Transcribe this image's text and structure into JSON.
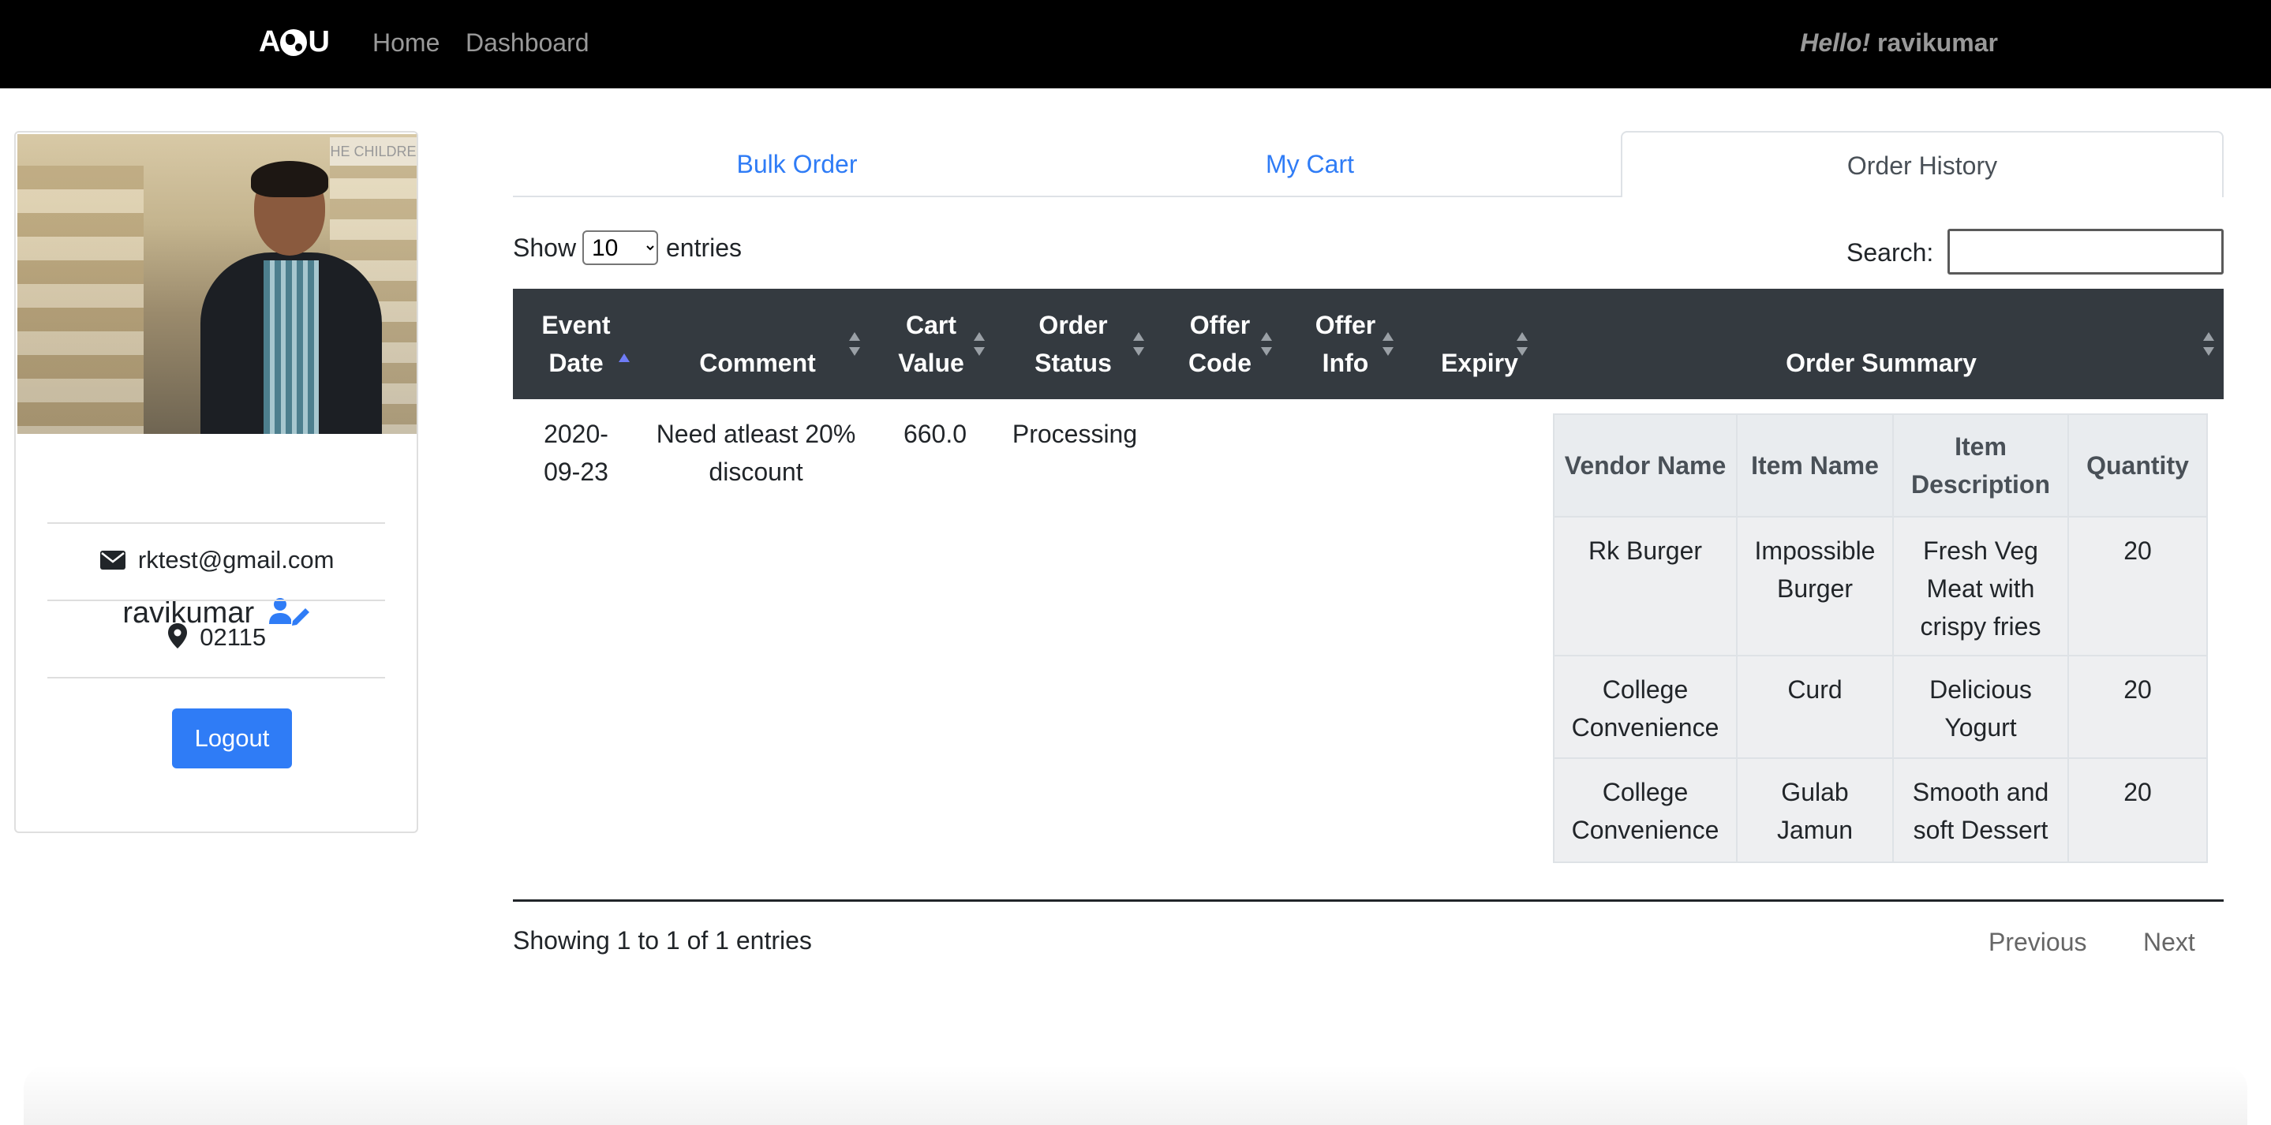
{
  "navbar": {
    "brand": "A",
    "brand_tail": "U",
    "links": [
      "Home",
      "Dashboard"
    ],
    "hello_prefix": "Hello!",
    "hello_user": "ravikumar"
  },
  "profile": {
    "name": "ravikumar",
    "email": "rktest@gmail.com",
    "zip": "02115",
    "logout_label": "Logout",
    "photo_sign": "HE CHILDRE"
  },
  "tabs": [
    {
      "label": "Bulk Order",
      "active": false
    },
    {
      "label": "My Cart",
      "active": false
    },
    {
      "label": "Order History",
      "active": true
    }
  ],
  "table_controls": {
    "show_label": "Show",
    "entries_value": "10",
    "entries_label": "entries",
    "search_label": "Search:",
    "search_value": ""
  },
  "columns": [
    "Event Date",
    "Comment",
    "Cart Value",
    "Order Status",
    "Offer Code",
    "Offer Info",
    "Expiry",
    "Order Summary"
  ],
  "rows": [
    {
      "event_date": "2020-09-23",
      "comment": "Need atleast 20% discount",
      "cart_value": "660.0",
      "order_status": "Processing",
      "offer_code": "",
      "offer_info": "",
      "expiry": "",
      "summary": {
        "columns": [
          "Vendor Name",
          "Item Name",
          "Item Description",
          "Quantity"
        ],
        "items": [
          {
            "vendor": "Rk Burger",
            "item": "Impossible Burger",
            "description": "Fresh Veg Meat with crispy fries",
            "quantity": "20"
          },
          {
            "vendor": "College Convenience",
            "item": "Curd",
            "description": "Delicious Yogurt",
            "quantity": "20"
          },
          {
            "vendor": "College Convenience",
            "item": "Gulab Jamun",
            "description": "Smooth and soft Dessert",
            "quantity": "20"
          }
        ]
      }
    }
  ],
  "footer": {
    "info": "Showing 1 to 1 of 1 entries",
    "previous": "Previous",
    "next": "Next"
  },
  "colors": {
    "navbar_bg": "#000000",
    "accent": "#2f7cf6",
    "table_header_bg": "#343a40",
    "nested_bg": "#eeeff1"
  }
}
